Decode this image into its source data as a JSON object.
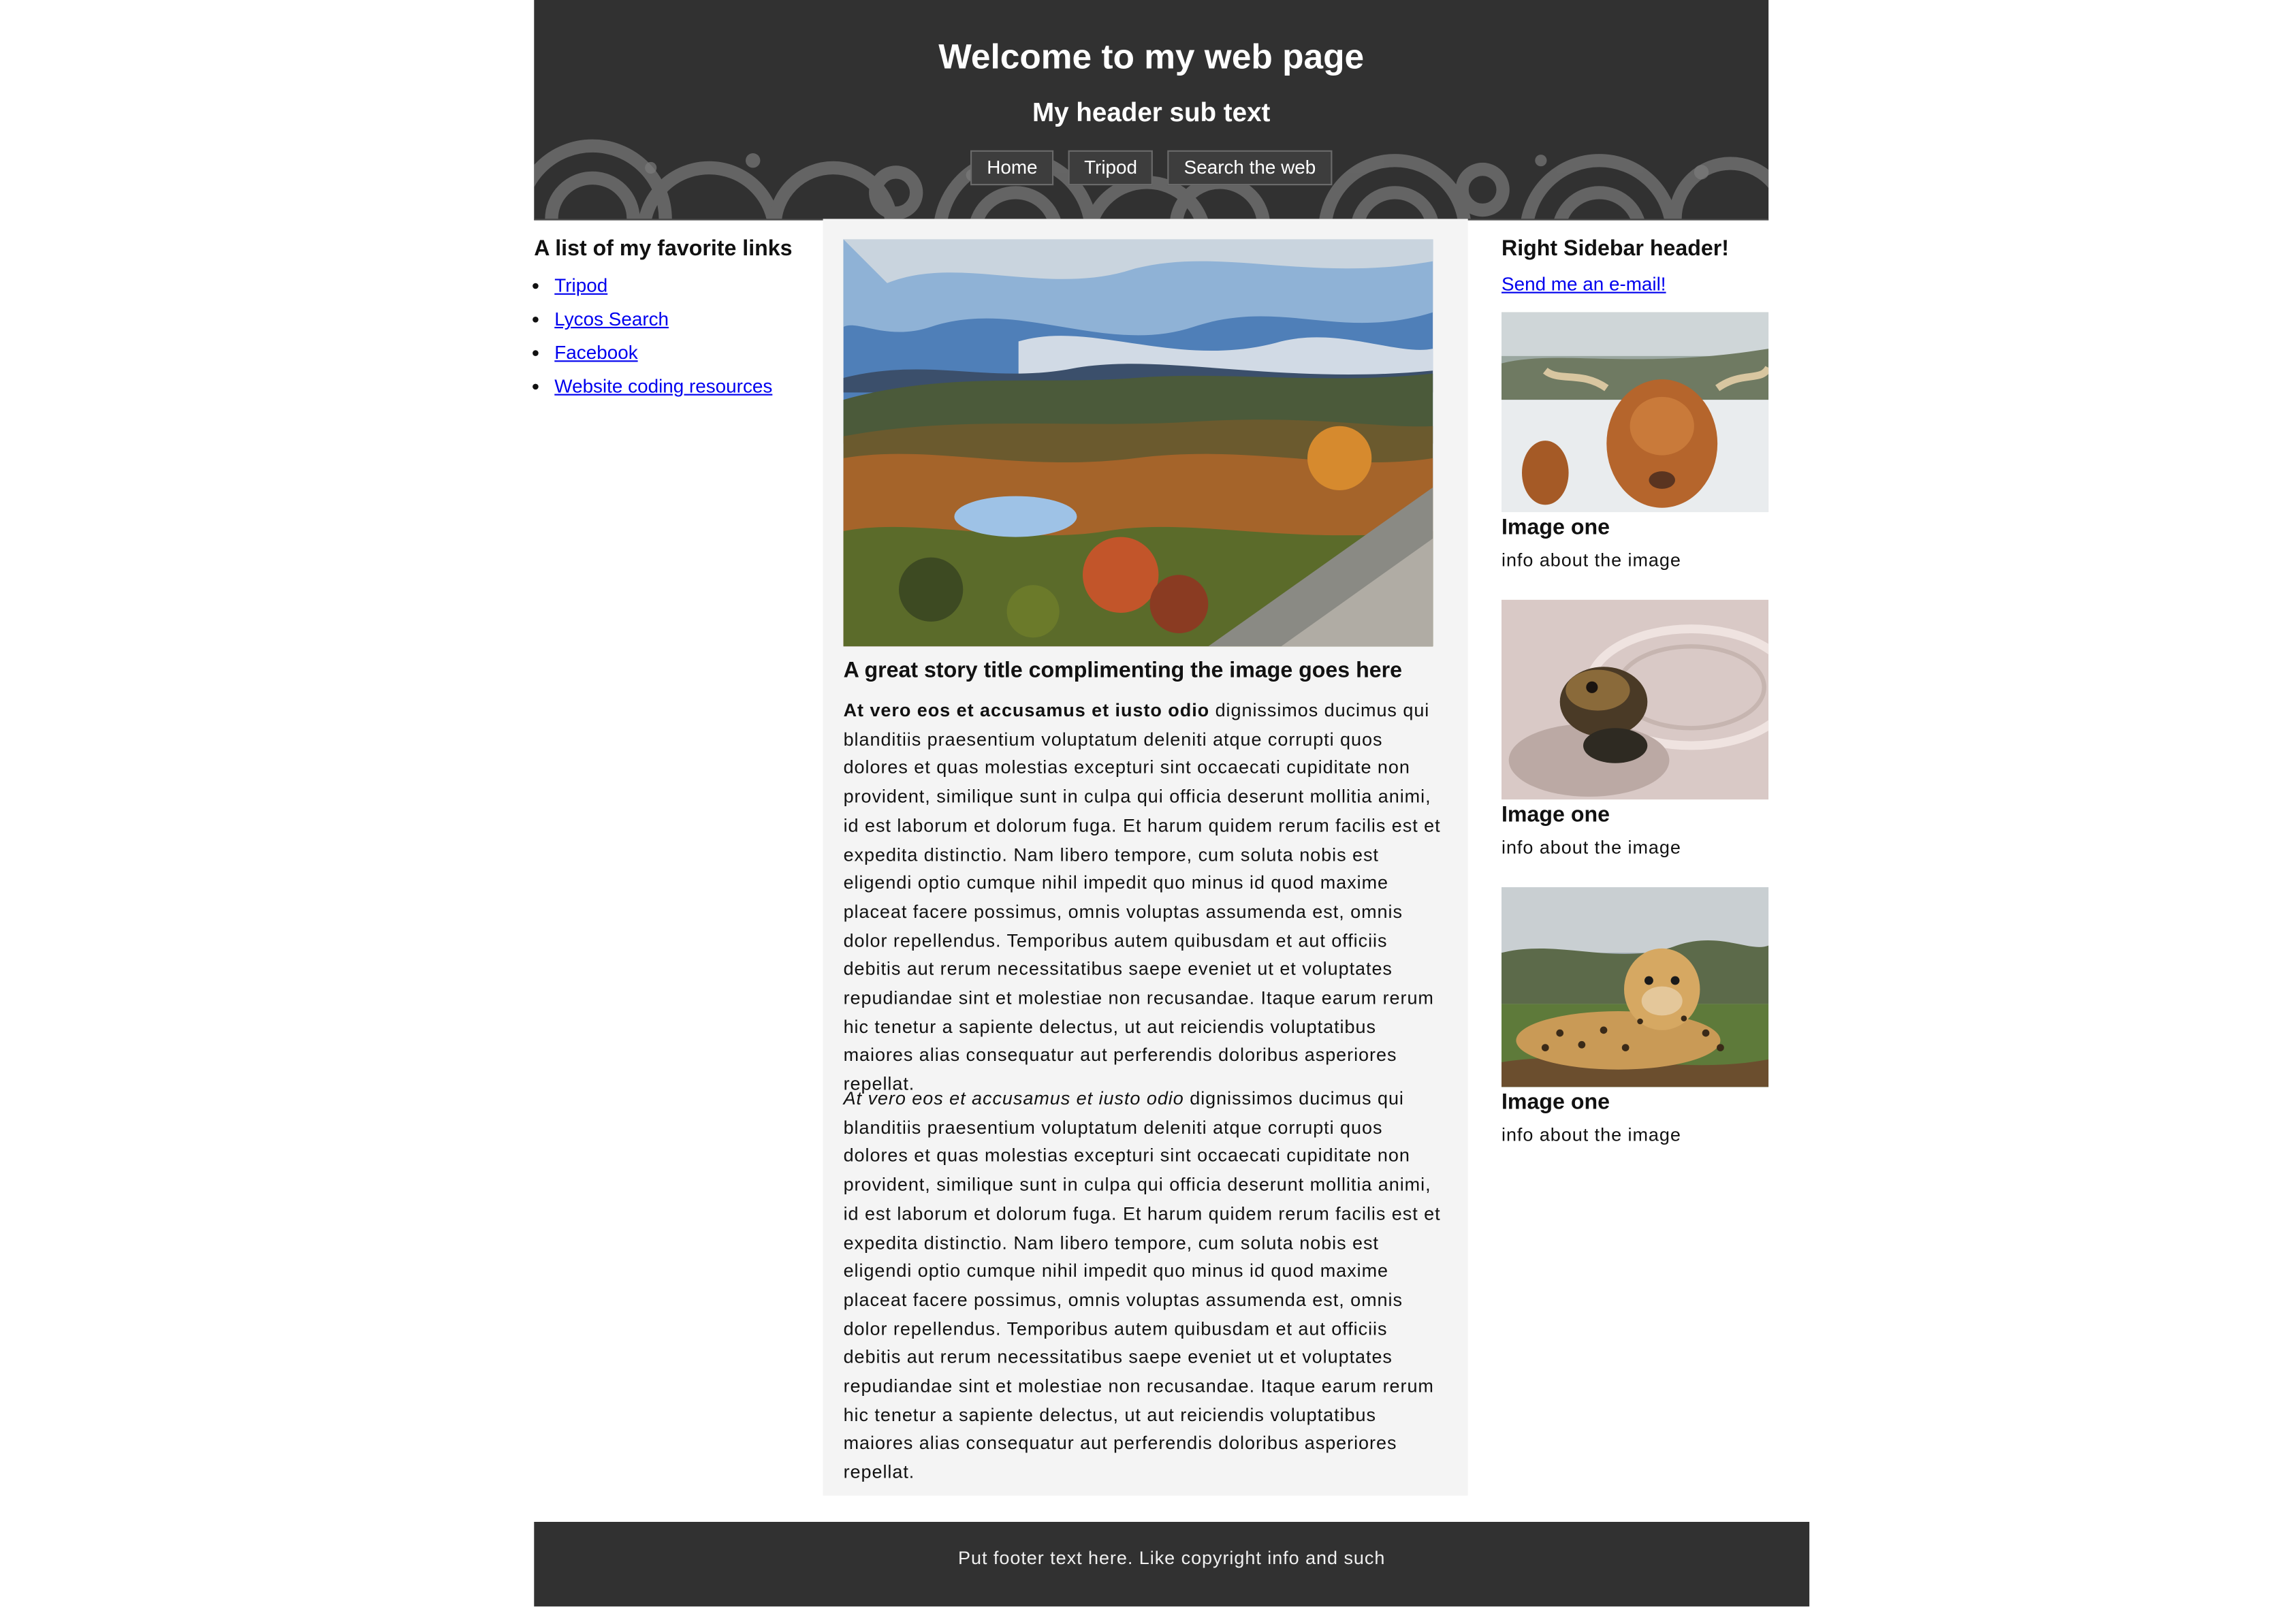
{
  "header": {
    "title": "Welcome to my web page",
    "subtitle": "My header sub text",
    "nav": [
      "Home",
      "Tripod",
      "Search the web"
    ],
    "bg_color": "#313131",
    "swirl_color": "#6e6e6e"
  },
  "left_sidebar": {
    "heading": "A list of my favorite links",
    "links": [
      "Tripod",
      "Lycos Search",
      "Facebook",
      "Website coding resources"
    ]
  },
  "main": {
    "image_name": "autumn-lake-landscape",
    "story_title": "A great story title complimenting the image goes here",
    "p1_bold": "At vero eos et accusamus et iusto odio",
    "p1_text": " dignissimos ducimus qui blanditiis praesentium voluptatum deleniti atque corrupti quos dolores et quas molestias excepturi sint occaecati cupiditate non provident, similique sunt in culpa qui officia deserunt mollitia animi, id est laborum et dolorum fuga. Et harum quidem rerum facilis est et expedita distinctio. Nam libero tempore, cum soluta nobis est eligendi optio cumque nihil impedit quo minus id quod maxime placeat facere possimus, omnis voluptas assumenda est, omnis dolor repellendus. Temporibus autem quibusdam et aut officiis debitis aut rerum necessitatibus saepe eveniet ut et voluptates repudiandae sint et molestiae non recusandae. Itaque earum rerum hic tenetur a sapiente delectus, ut aut reiciendis voluptatibus maiores alias consequatur aut perferendis doloribus asperiores repellat.",
    "p2_italic": "At vero eos et accusamus et iusto odio",
    "p2_text": " dignissimos ducimus qui blanditiis praesentium voluptatum deleniti atque corrupti quos dolores et quas molestias excepturi sint occaecati cupiditate non provident, similique sunt in culpa qui officia deserunt mollitia animi, id est laborum et dolorum fuga. Et harum quidem rerum facilis est et expedita distinctio. Nam libero tempore, cum soluta nobis est eligendi optio cumque nihil impedit quo minus id quod maxime placeat facere possimus, omnis voluptas assumenda est, omnis dolor repellendus. Temporibus autem quibusdam et aut officiis debitis aut rerum necessitatibus saepe eveniet ut et voluptates repudiandae sint et molestiae non recusandae. Itaque earum rerum hic tenetur a sapiente delectus, ut aut reiciendis voluptatibus maiores alias consequatur aut perferendis doloribus asperiores repellat.",
    "bg_color": "#f4f4f4"
  },
  "right_sidebar": {
    "heading": "Right Sidebar header!",
    "email_link": "Send me an e-mail!",
    "cards": [
      {
        "image": "highland-cattle-photo",
        "title": "Image one",
        "info": "info about the image"
      },
      {
        "image": "turtle-in-water-photo",
        "title": "Image one",
        "info": "info about the image"
      },
      {
        "image": "cheetah-photo",
        "title": "Image one",
        "info": "info about the image"
      }
    ]
  },
  "footer": {
    "text": "Put footer text here. Like copyright info and such"
  },
  "colors": {
    "link": "#0000ee",
    "text": "#111111",
    "page_bg": "#ffffff"
  }
}
